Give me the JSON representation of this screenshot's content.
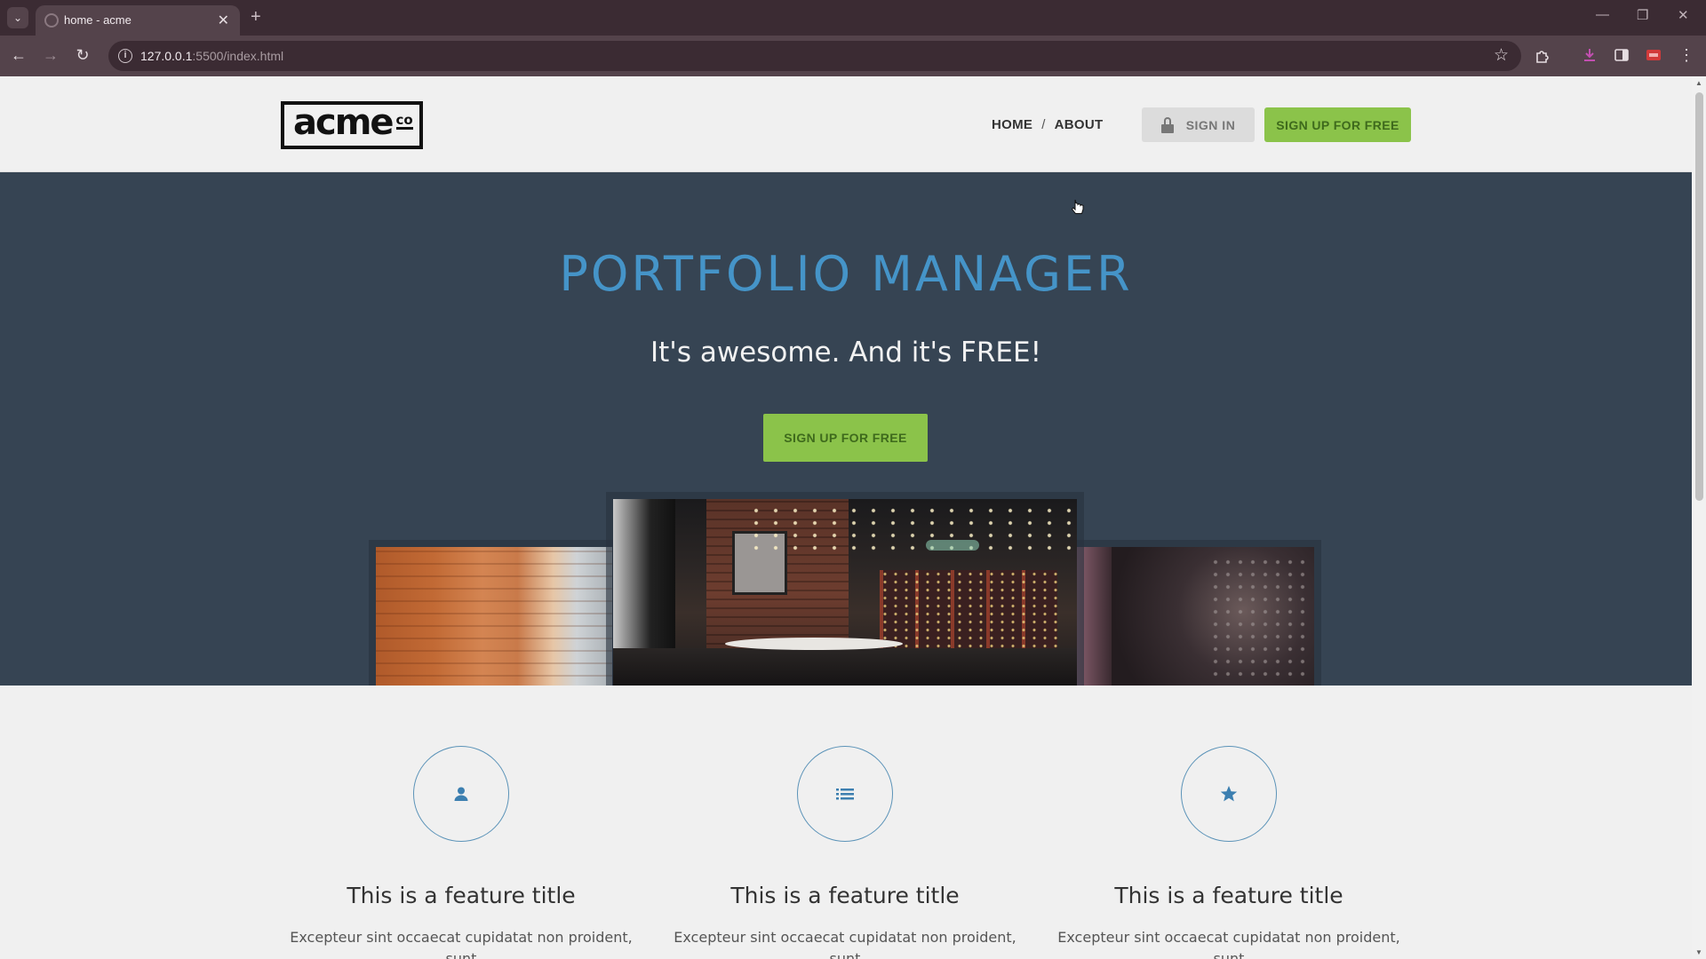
{
  "browser": {
    "tab_title": "home - acme",
    "url_host": "127.0.0.1",
    "url_rest": ":5500/index.html"
  },
  "site": {
    "logo_main": "acme",
    "logo_co": "co",
    "nav": {
      "home": "HOME",
      "separator": "/",
      "about": "ABOUT"
    },
    "signin_label": "SIGN IN",
    "signup_label": "SIGN UP FOR FREE"
  },
  "hero": {
    "title": "PORTFOLIO MANAGER",
    "subtitle": "It's awesome. And it's FREE!",
    "cta_label": "SIGN UP FOR FREE"
  },
  "features": [
    {
      "icon": "user-icon",
      "title": "This is a feature title",
      "text": "Excepteur sint occaecat cupidatat non proident, sunt"
    },
    {
      "icon": "list-icon",
      "title": "This is a feature title",
      "text": "Excepteur sint occaecat cupidatat non proident, sunt"
    },
    {
      "icon": "star-icon",
      "title": "This is a feature title",
      "text": "Excepteur sint occaecat cupidatat non proident, sunt"
    }
  ],
  "colors": {
    "hero_bg": "#364453",
    "hero_title": "#4594c8",
    "accent_green": "#8bc34a",
    "browser_frame": "#3b2b33"
  }
}
